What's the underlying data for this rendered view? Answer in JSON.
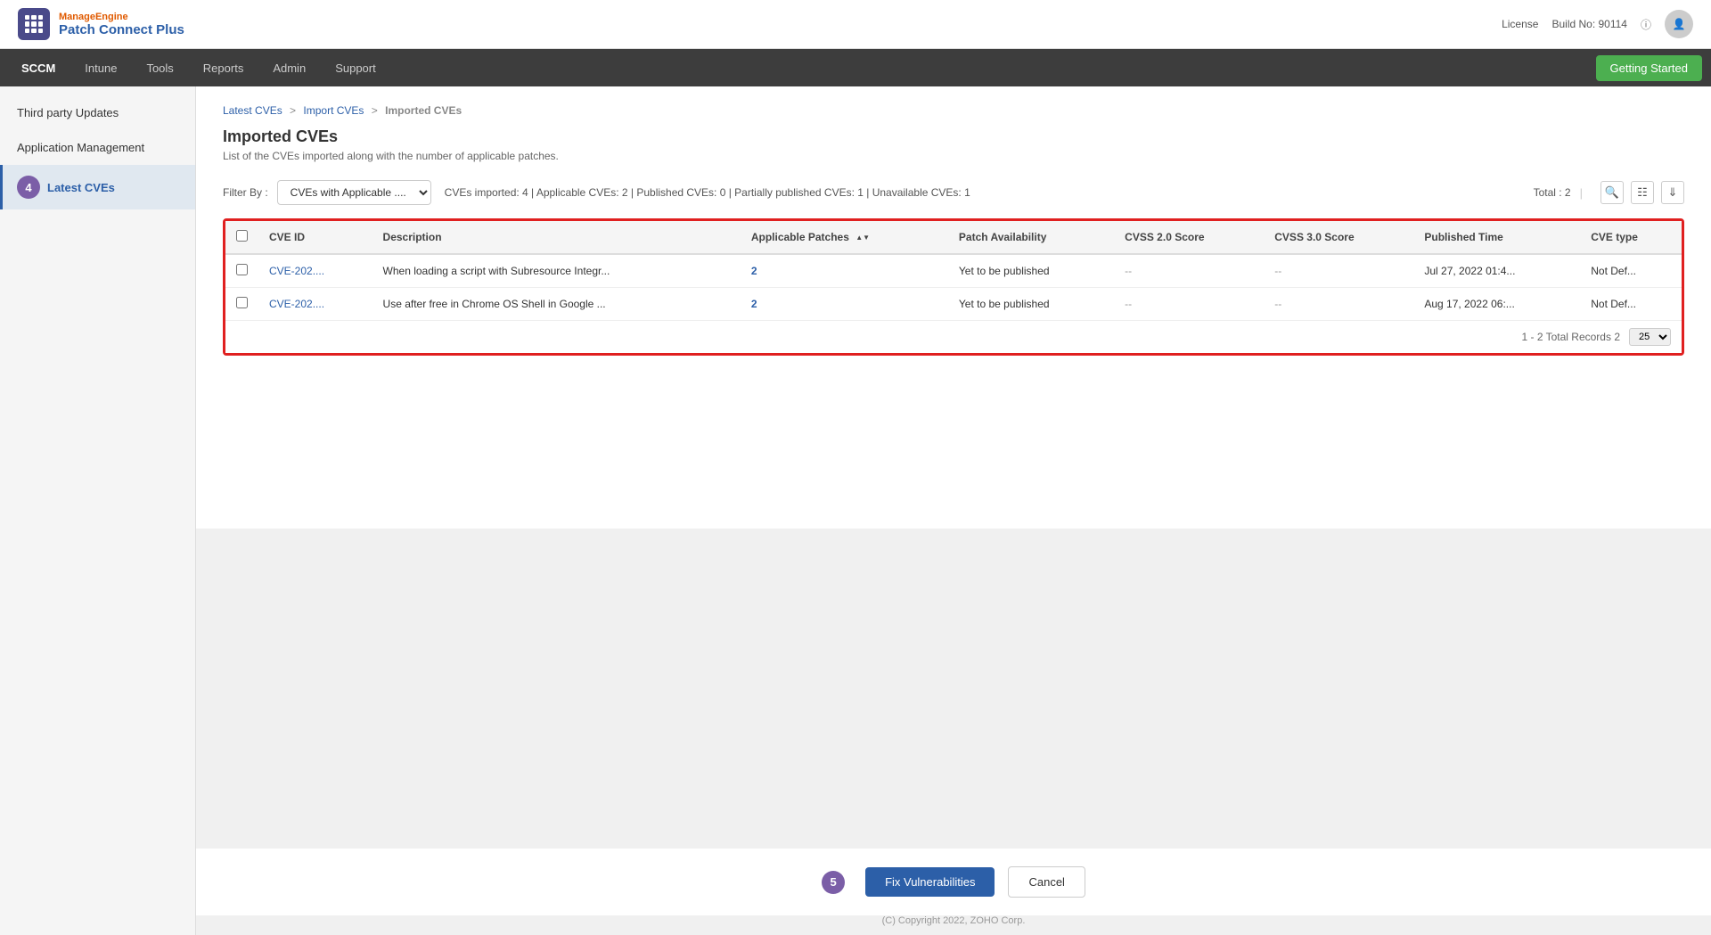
{
  "header": {
    "brand": "ManageEngine",
    "product": "Patch Connect Plus",
    "license_text": "License",
    "build_text": "Build No: 90114"
  },
  "nav": {
    "items": [
      {
        "label": "SCCM",
        "active": true
      },
      {
        "label": "Intune",
        "active": false
      },
      {
        "label": "Tools",
        "active": false
      },
      {
        "label": "Reports",
        "active": false
      },
      {
        "label": "Admin",
        "active": false
      },
      {
        "label": "Support",
        "active": false
      }
    ],
    "getting_started": "Getting Started"
  },
  "sidebar": {
    "items": [
      {
        "label": "Third party Updates",
        "active": false
      },
      {
        "label": "Application Management",
        "active": false
      },
      {
        "label": "Latest CVEs",
        "active": true
      }
    ]
  },
  "breadcrumb": {
    "items": [
      "Latest CVEs",
      "Import CVEs",
      "Imported CVEs"
    ]
  },
  "page": {
    "title": "Imported CVEs",
    "subtitle": "List of the CVEs imported along with the number of applicable patches.",
    "filter_label": "Filter By :",
    "filter_value": "CVEs with Applicable ....",
    "stats": "CVEs imported: 4  |  Applicable CVEs: 2  |  Published CVEs: 0  |  Partially published CVEs: 1  |  Unavailable CVEs: 1",
    "total_label": "Total : 2"
  },
  "table": {
    "columns": [
      {
        "key": "checkbox",
        "label": ""
      },
      {
        "key": "cve_id",
        "label": "CVE ID"
      },
      {
        "key": "description",
        "label": "Description"
      },
      {
        "key": "applicable_patches",
        "label": "Applicable Patches"
      },
      {
        "key": "patch_availability",
        "label": "Patch Availability"
      },
      {
        "key": "cvss2",
        "label": "CVSS 2.0 Score"
      },
      {
        "key": "cvss3",
        "label": "CVSS 3.0 Score"
      },
      {
        "key": "published_time",
        "label": "Published Time"
      },
      {
        "key": "cve_type",
        "label": "CVE type"
      }
    ],
    "rows": [
      {
        "cve_id": "CVE-202....",
        "description": "When loading a script with Subresource Integr...",
        "applicable_patches": "2",
        "patch_availability": "Yet to be published",
        "cvss2": "--",
        "cvss3": "--",
        "published_time": "Jul 27, 2022 01:4...",
        "cve_type": "Not Def..."
      },
      {
        "cve_id": "CVE-202....",
        "description": "Use after free in Chrome OS Shell in Google ...",
        "applicable_patches": "2",
        "patch_availability": "Yet to be published",
        "cvss2": "--",
        "cvss3": "--",
        "published_time": "Aug 17, 2022 06:...",
        "cve_type": "Not Def..."
      }
    ],
    "pagination": "1 - 2  Total Records 2",
    "page_size": "25"
  },
  "steps": {
    "sidebar_step": "4",
    "bottom_step": "5"
  },
  "buttons": {
    "fix_label": "Fix Vulnerabilities",
    "cancel_label": "Cancel"
  },
  "footer": {
    "copyright": "(C) Copyright 2022, ZOHO Corp."
  }
}
